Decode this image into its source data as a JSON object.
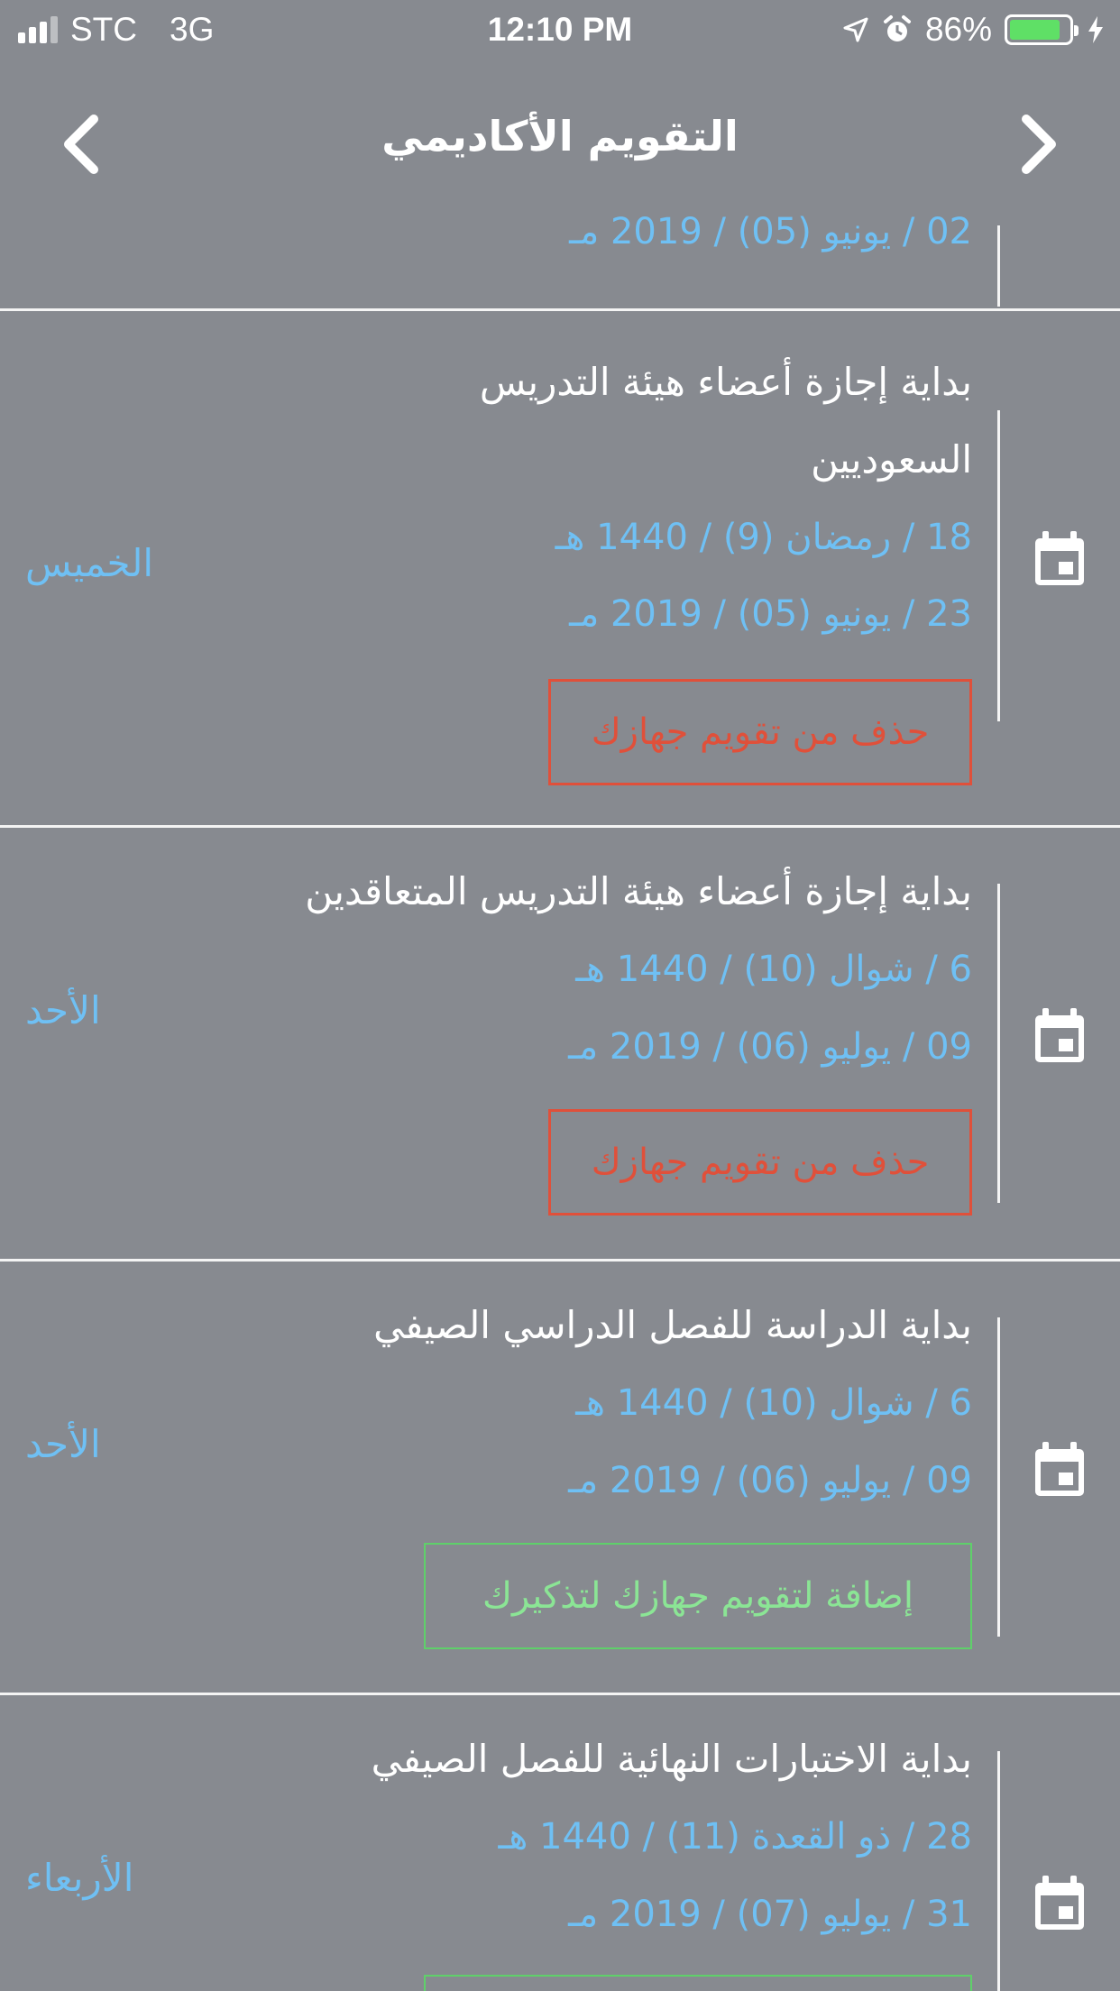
{
  "status_bar": {
    "carrier": "STC",
    "network": "3G",
    "time": "12:10 PM",
    "battery": "86%",
    "battery_level": 0.86,
    "battery_color": "#5fe066"
  },
  "nav": {
    "title": "التقويم الأكاديمي",
    "back_icon": "chevron-left-icon",
    "forward_icon": "chevron-right-icon"
  },
  "colors": {
    "background": "#878a90",
    "date_blue": "#6fc0f4",
    "delete_red": "#e0503a",
    "add_green": "#8be595"
  },
  "events": [
    {
      "partial_date": "02 / يونيو  (05) / 2019 مـ"
    },
    {
      "title_line1": "بداية إجازة أعضاء هيئة التدريس",
      "title_line2": "السعوديين",
      "hijri": "18 / رمضان (9) / 1440 هـ",
      "gregorian": "23 / يونيو  (05) / 2019 مـ",
      "day": "الخميس",
      "action": "حذف من تقويم جهازك",
      "action_type": "delete"
    },
    {
      "title_line1": "بداية إجازة أعضاء هيئة التدريس المتعاقدين",
      "hijri": "6 / شوال (10) / 1440 هـ",
      "gregorian": "09 / يوليو  (06) / 2019 مـ",
      "day": "الأحد",
      "action": "حذف من تقويم جهازك",
      "action_type": "delete"
    },
    {
      "title_line1": "بداية الدراسة للفصل الدراسي الصيفي",
      "hijri": "6 / شوال (10) / 1440 هـ",
      "gregorian": "09 / يوليو  (06) / 2019 مـ",
      "day": "الأحد",
      "action": "إضافة لتقويم جهازك لتذكيرك",
      "action_type": "add"
    },
    {
      "title_line1": "بداية الاختبارات النهائية للفصل الصيفي",
      "hijri": "28 / ذو القعدة (11) / 1440 هـ",
      "gregorian": "31 / يوليو  (07) / 2019 مـ",
      "day": "الأربعاء"
    }
  ]
}
